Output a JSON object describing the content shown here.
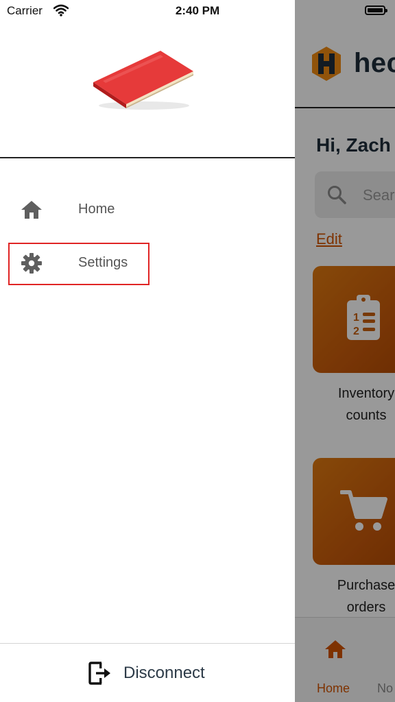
{
  "status_bar": {
    "carrier": "Carrier",
    "time": "2:40 PM"
  },
  "drawer": {
    "menu": [
      {
        "label": "Home",
        "icon": "home-icon"
      },
      {
        "label": "Settings",
        "icon": "gear-icon"
      }
    ],
    "footer": {
      "label": "Disconnect",
      "icon": "logout-icon"
    }
  },
  "app": {
    "logo_text": "hec",
    "greeting": "Hi, Zach",
    "search_placeholder": "Sear",
    "edit_label": "Edit",
    "tiles": [
      {
        "label_line1": "Inventory",
        "label_line2": "counts",
        "icon": "clipboard-list-icon"
      },
      {
        "label_line1": "Purchase",
        "label_line2": "orders",
        "icon": "shopping-cart-icon"
      }
    ],
    "tab_bar": [
      {
        "label": "Home",
        "icon": "home-icon"
      },
      {
        "label": "No"
      }
    ]
  },
  "colors": {
    "accent": "#d35400",
    "selection_outline": "#e02424",
    "tile_gradient_start": "#e07a10",
    "tile_gradient_end": "#b24a05"
  }
}
